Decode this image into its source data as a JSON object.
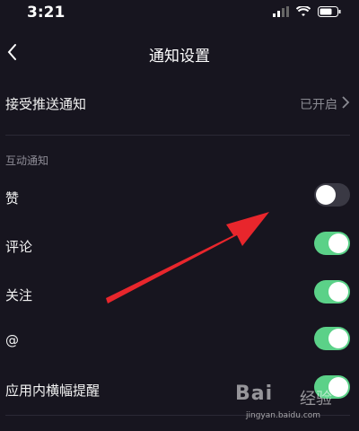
{
  "status_bar": {
    "time": "3:21"
  },
  "header": {
    "title": "通知设置"
  },
  "push": {
    "label": "接受推送通知",
    "status": "已开启"
  },
  "section": {
    "title": "互动通知"
  },
  "toggles": [
    {
      "label": "赞",
      "on": false
    },
    {
      "label": "评论",
      "on": true
    },
    {
      "label": "关注",
      "on": true
    },
    {
      "label": "@",
      "on": true
    },
    {
      "label": "应用内横幅提醒",
      "on": true
    }
  ],
  "watermark": {
    "logo": "Bai",
    "logo_suffix": "经验",
    "url": "jingyan.baidu.com"
  },
  "colors": {
    "background": "#17151f",
    "toggle_on": "#5bd188",
    "toggle_off": "#3a3944",
    "arrow": "#e8262c"
  }
}
